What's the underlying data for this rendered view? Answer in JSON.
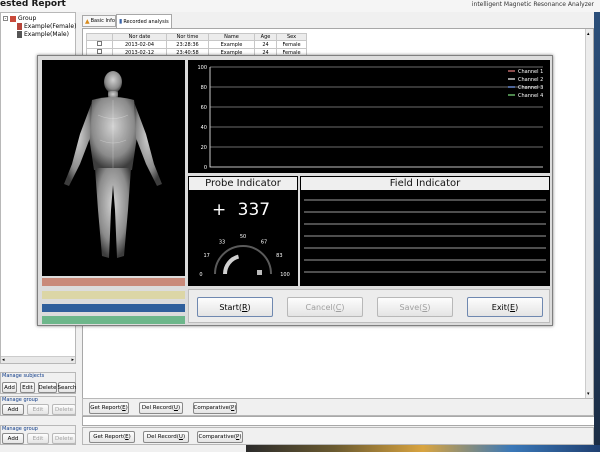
{
  "app": {
    "title": "ested Report",
    "product": "intelligent Magnetic Resonance Analyzer"
  },
  "tree": {
    "root": "Group",
    "items": [
      "Example(Female)",
      "Example(Male)"
    ]
  },
  "tabs": [
    "Basic Info",
    "Recorded analysis"
  ],
  "table": {
    "columns": [
      "",
      "Nor date",
      "Nor time",
      "Name",
      "Age",
      "Sex"
    ],
    "rows": [
      [
        "",
        "2013-02-04",
        "23:28:36",
        "Example",
        "24",
        "Female"
      ],
      [
        "",
        "2013-02-12",
        "23:40:58",
        "Example",
        "24",
        "Female"
      ]
    ]
  },
  "sidebar": {
    "manage_subjects": {
      "label": "Manage subjects",
      "add": "Add",
      "edit": "Edit",
      "delete": "Delete",
      "search": "Search"
    },
    "manage_group_1": {
      "label": "Manage group",
      "add": "Add",
      "edit": "Edit",
      "delete": "Delete"
    },
    "manage_group_2": {
      "label": "Manage group",
      "add": "Add",
      "edit": "Edit",
      "delete": "Delete"
    }
  },
  "bottom_bar_1": {
    "get_report": "Get Report(",
    "get_report_key": "E",
    "del_record": "Del Record(",
    "del_record_key": "U",
    "comparative": "Comparative(",
    "comparative_key": "P"
  },
  "bottom_bar_2": {
    "get_report": "Get Report(",
    "get_report_key": "E",
    "del_record": "Del Record(",
    "del_record_key": "U",
    "comparative": "Comparative(",
    "comparative_key": "P"
  },
  "dialog": {
    "probe_title": "Probe Indicator",
    "field_title": "Field Indicator",
    "probe_sign": "+",
    "probe_value": "337",
    "gauge_labels": [
      "0",
      "17",
      "33",
      "50",
      "67",
      "83",
      "100"
    ],
    "gauge_level": 0.42,
    "buttons": {
      "start": "Start(",
      "start_key": "R",
      "cancel": "Cancel(",
      "cancel_key": "C",
      "save": "Save(",
      "save_key": "S",
      "exit": "Exit(",
      "exit_key": "E",
      "close": ")"
    },
    "color_bars": [
      "#c98a7a",
      "#dcd6a6",
      "#2f5f9c",
      "#6db78b"
    ]
  },
  "chart_data": {
    "type": "line",
    "ylim": [
      0,
      100
    ],
    "yticks": [
      "0",
      "20",
      "40",
      "60",
      "80",
      "100"
    ],
    "grid": true,
    "legend_position": "top-right",
    "series": [
      {
        "name": "Channel 1",
        "color": "#e88080",
        "values": []
      },
      {
        "name": "Channel 2",
        "color": "#ffffff",
        "values": []
      },
      {
        "name": "Channel 3",
        "color": "#80a8ff",
        "values": []
      },
      {
        "name": "Channel 4",
        "color": "#7fe07f",
        "values": []
      }
    ]
  }
}
